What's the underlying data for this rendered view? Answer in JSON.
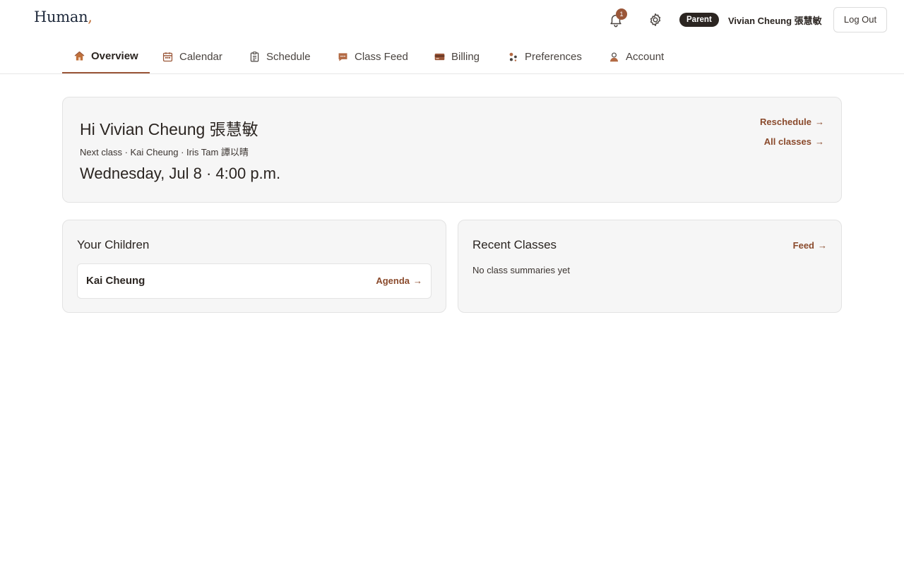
{
  "app": {
    "logo_text": "Human",
    "logo_comma": ","
  },
  "header": {
    "notification_count": "1",
    "role_badge": "Parent",
    "user_name": "Vivian Cheung 張慧敏",
    "logout_label": "Log Out"
  },
  "tabs": [
    {
      "label": "Overview",
      "icon": "home-icon",
      "active": true
    },
    {
      "label": "Calendar",
      "icon": "calendar-icon",
      "active": false
    },
    {
      "label": "Schedule",
      "icon": "clipboard-icon",
      "active": false
    },
    {
      "label": "Class Feed",
      "icon": "chat-icon",
      "active": false
    },
    {
      "label": "Billing",
      "icon": "credit-card-icon",
      "active": false
    },
    {
      "label": "Preferences",
      "icon": "preferences-icon",
      "active": false
    },
    {
      "label": "Account",
      "icon": "user-icon",
      "active": false
    }
  ],
  "hero": {
    "greeting": "Hi Vivian Cheung 張慧敏",
    "next_class": "Next class · Kai Cheung · Iris Tam 譚以晴",
    "when": "Wednesday, Jul 8 · 4:00 p.m.",
    "reschedule_label": "Reschedule",
    "all_classes_label": "All classes"
  },
  "children": {
    "title": "Your Children",
    "items": [
      {
        "name": "Kai Cheung",
        "link_label": "Agenda"
      }
    ]
  },
  "recent": {
    "title": "Recent Classes",
    "link_label": "Feed",
    "empty_text": "No class summaries yet"
  },
  "colors": {
    "accent": "#9a5638",
    "link": "#8a4a2c",
    "pill_bg": "#2b2521",
    "card_bg": "#f6f6f6"
  }
}
